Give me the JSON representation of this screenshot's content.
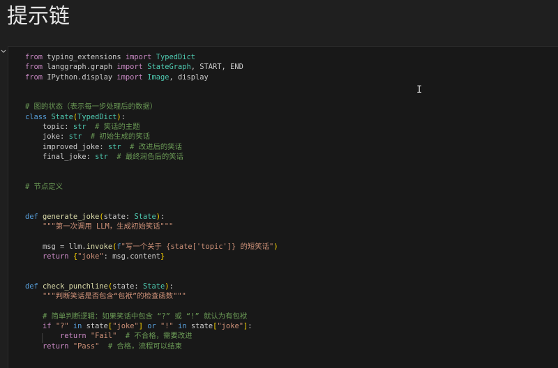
{
  "heading": "提示链",
  "code_lines": [
    "from typing_extensions import TypedDict",
    "from langgraph.graph import StateGraph, START, END",
    "from IPython.display import Image, display",
    "",
    "",
    "# 图的状态（表示每一步处理后的数据）",
    "class State(TypedDict):",
    "    topic: str  # 笑话的主题",
    "    joke: str  # 初始生成的笑话",
    "    improved_joke: str  # 改进后的笑话",
    "    final_joke: str  # 最终润色后的笑话",
    "",
    "",
    "# 节点定义",
    "",
    "",
    "def generate_joke(state: State):",
    "    \"\"\"第一次调用 LLM，生成初始笑话\"\"\"",
    "",
    "    msg = llm.invoke(f\"写一个关于 {state['topic']} 的短笑话\")",
    "    return {\"joke\": msg.content}",
    "",
    "",
    "def check_punchline(state: State):",
    "    \"\"\"判断笑话是否包含“包袱”的检查函数\"\"\"",
    "",
    "    # 简单判断逻辑：如果笑话中包含 “?” 或 “!” 就认为有包袱",
    "    if \"?\" in state[\"joke\"] or \"!\" in state[\"joke\"]:",
    "        return \"Fail\"  # 不合格，需要改进",
    "    return \"Pass\"  # 合格，流程可以结束"
  ],
  "icons": {
    "collapse": "chevron-down-icon",
    "cursor": "text-cursor-icon"
  },
  "colors": {
    "keyword": "#569cd6",
    "control": "#c586c0",
    "function": "#dcdcaa",
    "string": "#ce9178",
    "comment": "#6a9955",
    "type": "#4ec9b0"
  }
}
